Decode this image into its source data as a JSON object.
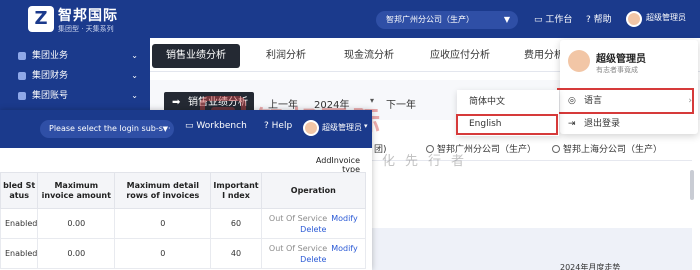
{
  "background_app": {
    "brand": {
      "logo_letter": "Z",
      "name": "智邦国际",
      "sub": "集团型 · 天集系列"
    },
    "header": {
      "tenant": "智邦广州分公司（生产）",
      "workbench": "工作台",
      "help": "帮助",
      "user": "超级管理员"
    },
    "sidebar": {
      "items": [
        {
          "label": "集团业务"
        },
        {
          "label": "集团财务"
        },
        {
          "label": "集团账号"
        }
      ]
    },
    "tabs": [
      {
        "label": "销售业绩分析",
        "active": true
      },
      {
        "label": "利润分析"
      },
      {
        "label": "现金流分析"
      },
      {
        "label": "应收应付分析"
      },
      {
        "label": "费用分析"
      }
    ],
    "toolbar": {
      "report_button": "销售业绩分析",
      "prev_year": "上一年",
      "year": "2024年",
      "next_year": "下一年"
    },
    "radios": [
      {
        "label": "团)"
      },
      {
        "label": "智邦广州分公司（生产）"
      },
      {
        "label": "智邦上海分公司（生产）"
      }
    ],
    "chart_caption": "2024年月度走势"
  },
  "user_dropdown": {
    "name": "超级管理员",
    "motto": "有志者事竟成",
    "language_label": "语言",
    "logout_label": "退出登录"
  },
  "language_menu": {
    "options": [
      "简体中文",
      "English"
    ]
  },
  "watermark": {
    "title": "智邦国际",
    "subtitle": "数据一体化先行者"
  },
  "overlay_app": {
    "header": {
      "tenant_placeholder": "Please select the login sub-s···",
      "workbench": "Workbench",
      "help": "Help",
      "user": "超级管理员"
    },
    "add_button": "AddInvoice type",
    "table": {
      "columns": [
        "Enabled Status",
        "Maximum invoice amount",
        "Maximum detail rows of invoices",
        "Important Index",
        "Operation"
      ],
      "column_display": [
        "bled St atus",
        "Maximum invoice amount",
        "Maximum detail rows of invoices",
        "Important I ndex",
        "Operation"
      ],
      "rows": [
        {
          "status": "Enabled",
          "max_amount": "0.00",
          "max_rows": "0",
          "index": "60",
          "op_service": "Out Of Service",
          "op_modify": "Modify",
          "op_delete": "Delete"
        },
        {
          "status": "Enabled",
          "max_amount": "0.00",
          "max_rows": "0",
          "index": "40",
          "op_service": "Out Of Service",
          "op_modify": "Modify",
          "op_delete": "Delete"
        }
      ]
    }
  },
  "colors": {
    "header_blue": "#1b3a8c",
    "active_tab": "#242933",
    "highlight_red": "#d63a3a",
    "enabled_green": "#2a9d3a",
    "link_blue": "#2c5bd6"
  }
}
